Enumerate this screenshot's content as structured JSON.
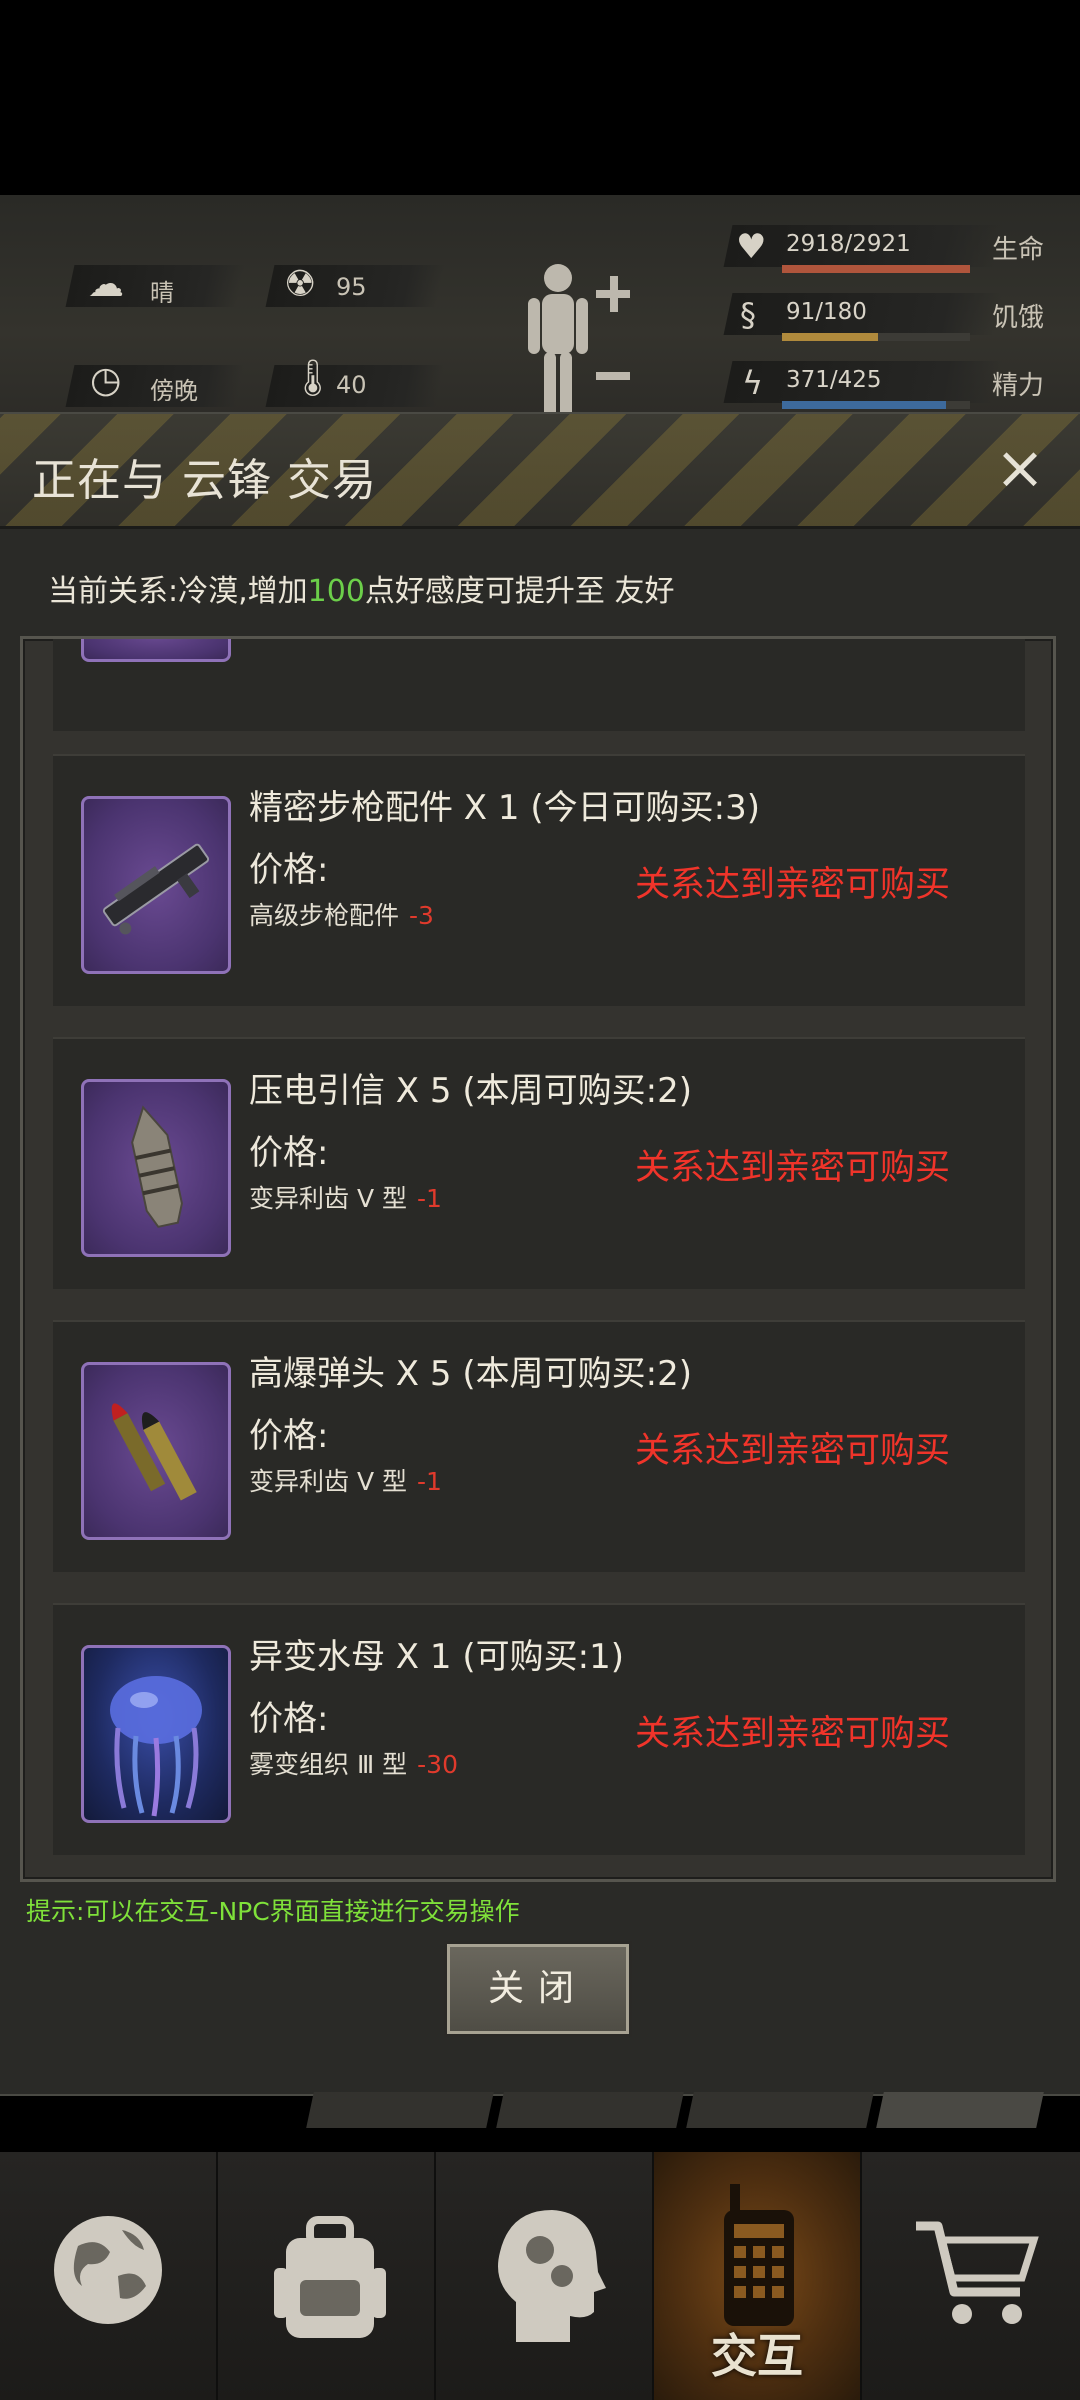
{
  "status": {
    "weather": "晴",
    "radiation": "95",
    "time_of_day": "傍晚",
    "temperature": "40",
    "vitals": [
      {
        "label": "生命",
        "value": "2918/2921",
        "fraction": 0.999,
        "color": "#b0553c",
        "icon": "heart-icon"
      },
      {
        "label": "饥饿",
        "value": "91/180",
        "fraction": 0.51,
        "color": "#b08a3c",
        "icon": "stomach-icon"
      },
      {
        "label": "精力",
        "value": "371/425",
        "fraction": 0.87,
        "color": "#3d6a9c",
        "icon": "energy-icon"
      }
    ]
  },
  "dialog": {
    "title": "正在与 云锋 交易",
    "close_icon": "×",
    "relation_prefix": "当前关系:冷漠,增加",
    "relation_points": "100",
    "relation_suffix": "点好感度可提升至 友好",
    "items": [
      {
        "name": "精密步枪配件 X 1 (今日可购买:3)",
        "price_label": "价格:",
        "price_item": "高级步枪配件",
        "price_amount": "-3",
        "requirement": "关系达到亲密可购买",
        "icon": "rifle-part-icon"
      },
      {
        "name": "压电引信 X 5 (本周可购买:2)",
        "price_label": "价格:",
        "price_item": "变异利齿 V 型",
        "price_amount": "-1",
        "requirement": "关系达到亲密可购买",
        "icon": "fuse-icon"
      },
      {
        "name": "高爆弹头 X 5 (本周可购买:2)",
        "price_label": "价格:",
        "price_item": "变异利齿 V 型",
        "price_amount": "-1",
        "requirement": "关系达到亲密可购买",
        "icon": "warhead-icon"
      },
      {
        "name": "异变水母 X 1 (可购买:1)",
        "price_label": "价格:",
        "price_item": "雾变组织 Ⅲ 型",
        "price_amount": "-30",
        "requirement": "关系达到亲密可购买",
        "icon": "jellyfish-icon"
      }
    ],
    "tip": "提示:可以在交互-NPC界面直接进行交易操作",
    "close_button": "关闭"
  },
  "nav": {
    "items": [
      {
        "label": "",
        "icon": "globe-icon"
      },
      {
        "label": "",
        "icon": "backpack-icon"
      },
      {
        "label": "",
        "icon": "head-gears-icon"
      },
      {
        "label": "交互",
        "icon": "walkie-talkie-icon"
      },
      {
        "label": "",
        "icon": "cart-icon"
      }
    ]
  }
}
